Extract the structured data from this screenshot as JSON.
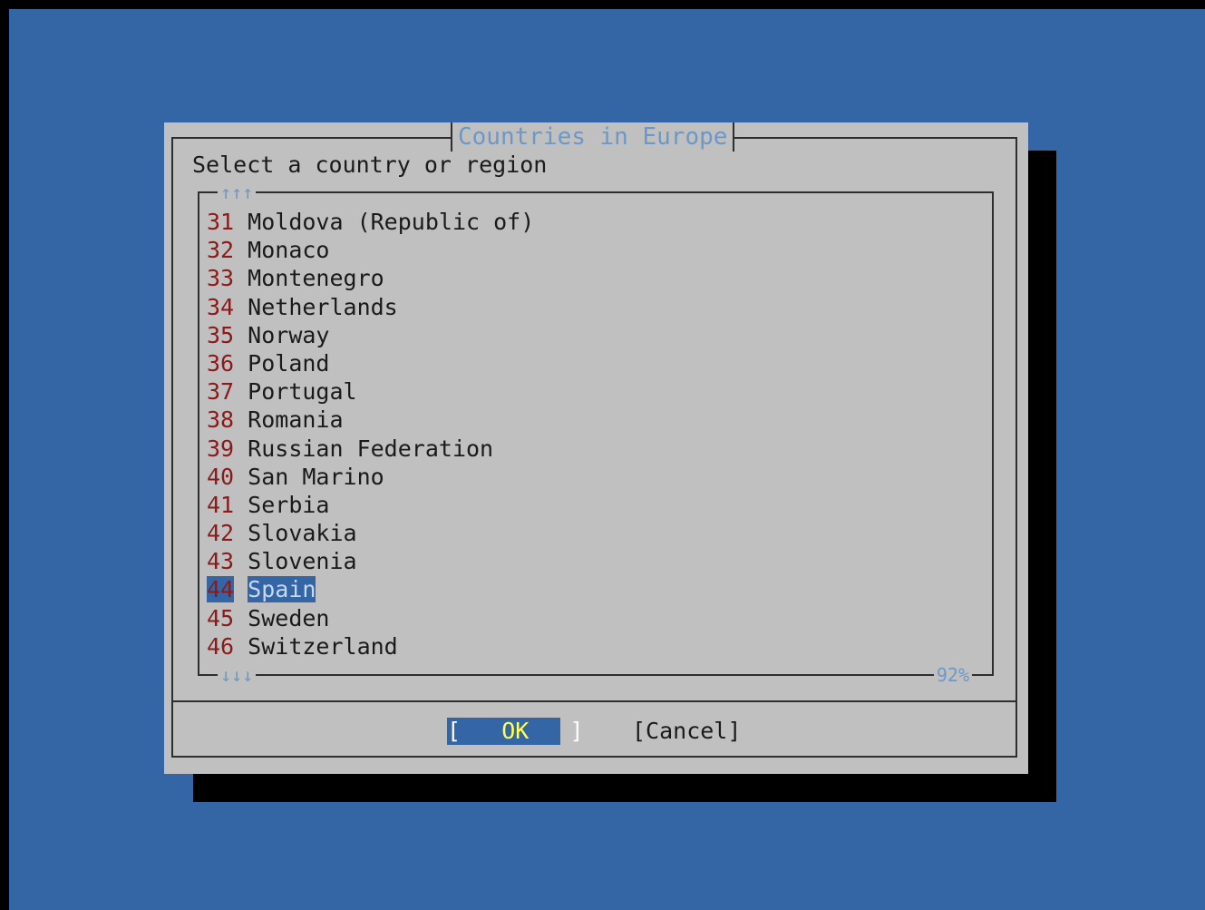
{
  "dialog": {
    "title": "Countries in Europe",
    "prompt": "Select a country or region",
    "scroll_up": "↑↑↑",
    "scroll_down": "↓↓↓",
    "scroll_percent": "92%"
  },
  "list": {
    "items": [
      {
        "num": "31",
        "name": "Moldova (Republic of)"
      },
      {
        "num": "32",
        "name": "Monaco"
      },
      {
        "num": "33",
        "name": "Montenegro"
      },
      {
        "num": "34",
        "name": "Netherlands"
      },
      {
        "num": "35",
        "name": "Norway"
      },
      {
        "num": "36",
        "name": "Poland"
      },
      {
        "num": "37",
        "name": "Portugal"
      },
      {
        "num": "38",
        "name": "Romania"
      },
      {
        "num": "39",
        "name": "Russian Federation"
      },
      {
        "num": "40",
        "name": "San Marino"
      },
      {
        "num": "41",
        "name": "Serbia"
      },
      {
        "num": "42",
        "name": "Slovakia"
      },
      {
        "num": "43",
        "name": "Slovenia"
      },
      {
        "num": "44",
        "name": "Spain"
      },
      {
        "num": "45",
        "name": "Sweden"
      },
      {
        "num": "46",
        "name": "Switzerland"
      }
    ],
    "selected_index": 13
  },
  "buttons": {
    "ok_left": "[",
    "ok_label": "OK",
    "ok_right": "]",
    "cancel": "[Cancel]"
  },
  "colors": {
    "desktop": "#3465a4",
    "dialog": "#c0c0c0",
    "title_text": "#6c98c8",
    "number_text": "#8b1a1a",
    "ok_label": "#ffff55"
  }
}
